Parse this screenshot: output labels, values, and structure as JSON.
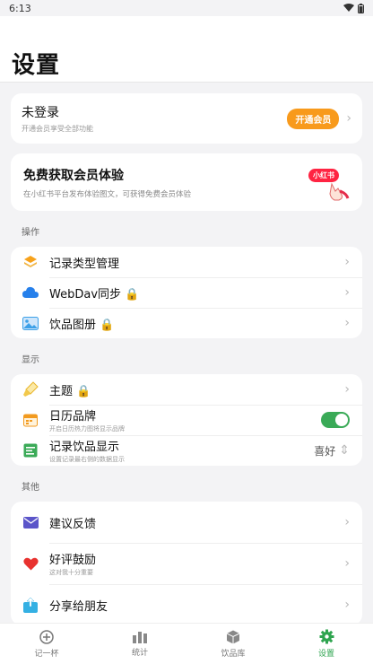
{
  "status": {
    "time": "6:13"
  },
  "header": {
    "title": "设置"
  },
  "login": {
    "title": "未登录",
    "subtitle": "开通会员享受全部功能",
    "vip_button": "开通会员"
  },
  "promo": {
    "title": "免费获取会员体验",
    "subtitle": "在小红书平台发布体验图文，可获得免费会员体验",
    "badge": "小红书"
  },
  "sections": {
    "operations": {
      "label": "操作",
      "items": [
        {
          "label": "记录类型管理"
        },
        {
          "label": "WebDav同步 🔒"
        },
        {
          "label": "饮品图册 🔒"
        }
      ]
    },
    "display": {
      "label": "显示",
      "items": [
        {
          "label": "主题 🔒"
        },
        {
          "label": "日历品牌",
          "subtitle": "开启日历热力图将显示品牌"
        },
        {
          "label": "记录饮品显示",
          "subtitle": "设置记录最右侧的数据显示",
          "value": "喜好"
        }
      ]
    },
    "other": {
      "label": "其他",
      "items": [
        {
          "label": "建议反馈"
        },
        {
          "label": "好评鼓励",
          "subtitle": "这对我十分重要"
        },
        {
          "label": "分享给朋友"
        }
      ]
    }
  },
  "tabs": [
    {
      "label": "记一杯"
    },
    {
      "label": "统计"
    },
    {
      "label": "饮品库"
    },
    {
      "label": "设置"
    }
  ],
  "colors": {
    "accent": "#2ea44f",
    "vip": "#f89a1c",
    "xhs": "#ff2442"
  }
}
